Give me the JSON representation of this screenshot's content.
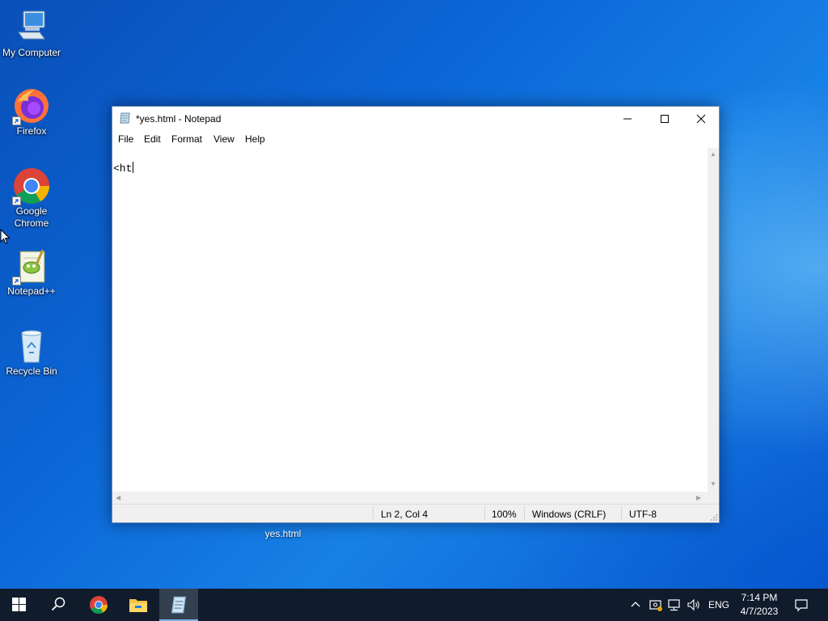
{
  "desktop": {
    "icons": [
      {
        "label": "My Computer"
      },
      {
        "label": "Firefox"
      },
      {
        "label": "Google Chrome"
      },
      {
        "label": "Notepad++"
      },
      {
        "label": "Recycle Bin"
      }
    ],
    "file_label": "yes.html"
  },
  "notepad": {
    "title": "*yes.html - Notepad",
    "menu": [
      "File",
      "Edit",
      "Format",
      "View",
      "Help"
    ],
    "content": "<ht",
    "status": {
      "position": "Ln 2, Col 4",
      "zoom": "100%",
      "line_ending": "Windows (CRLF)",
      "encoding": "UTF-8"
    }
  },
  "taskbar": {
    "language": "ENG",
    "time": "7:14 PM",
    "date": "4/7/2023",
    "pinned": [
      "start-icon",
      "search-icon",
      "chrome-icon",
      "file-explorer-icon",
      "notepad-icon"
    ]
  },
  "colors": {
    "taskbar": "#101b2c",
    "active_underline": "#7fb2e6",
    "window_border": "#6e8fb8"
  }
}
